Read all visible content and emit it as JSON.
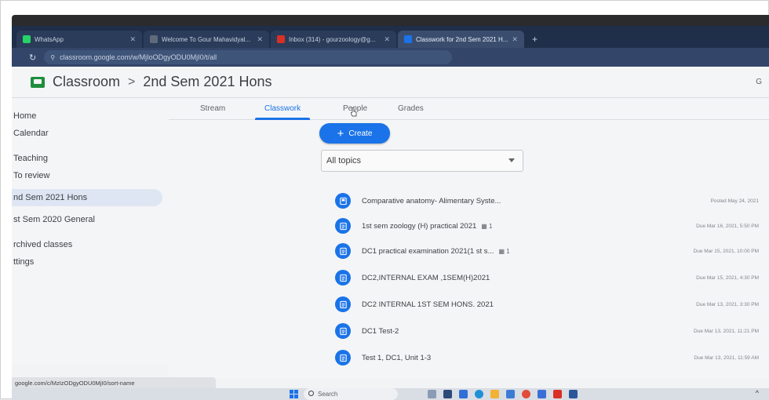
{
  "browser": {
    "tabs": [
      {
        "label": "WhatsApp",
        "color": "#25d366",
        "active": false
      },
      {
        "label": "Welcome To Gour Mahavidyal...",
        "color": "#5f6b7a",
        "active": false
      },
      {
        "label": "Inbox (314) - gourzoology@g...",
        "color": "#d93025",
        "active": false
      },
      {
        "label": "Classwork for 2nd Sem 2021 H...",
        "color": "#1a73e8",
        "active": true
      }
    ],
    "newtab": "+",
    "nav_back": "←",
    "nav_reload": "↻",
    "url": "classroom.google.com/w/MjIoODgyODU0MjI0/t/all"
  },
  "app": {
    "title": "Classroom",
    "separator": ">",
    "class_name": "2nd Sem 2021 Hons",
    "right_glyph": "G"
  },
  "sidebar": {
    "items": [
      {
        "label": "Home",
        "selected": false
      },
      {
        "label": "Calendar",
        "selected": false
      },
      {
        "label": "Teaching",
        "selected": false
      },
      {
        "label": "To review",
        "selected": false
      },
      {
        "label": "nd Sem 2021 Hons",
        "selected": true
      },
      {
        "label": "st Sem 2020 General",
        "selected": false
      },
      {
        "label": "rchived classes",
        "selected": false
      },
      {
        "label": "ttings",
        "selected": false
      }
    ]
  },
  "class_tabs": [
    {
      "label": "Stream",
      "active": false
    },
    {
      "label": "Classwork",
      "active": true
    },
    {
      "label": "People",
      "active": false
    },
    {
      "label": "Grades",
      "active": false
    }
  ],
  "classwork": {
    "create_label": "Create",
    "create_plus": "+",
    "topic_filter": "All topics",
    "items": [
      {
        "title": "Comparative anatomy- Alimentary Syste...",
        "badge": "",
        "date": "Posted May 24, 2021",
        "icon": "material-icon"
      },
      {
        "title": "1st sem zoology (H) practical 2021",
        "badge": "▦ 1",
        "date": "Due Mar 16, 2021, 5:50 PM",
        "icon": "assignment-icon"
      },
      {
        "title": "DC1 practical examination 2021(1 st s...",
        "badge": "▦ 1",
        "date": "Due Mar 15, 2021, 10:00 PM",
        "icon": "assignment-icon"
      },
      {
        "title": "DC2,INTERNAL EXAM ,1SEM(H)2021",
        "badge": "",
        "date": "Due Mar 15, 2021, 4:30 PM",
        "icon": "assignment-icon"
      },
      {
        "title": "DC2 INTERNAL 1ST SEM HONS. 2021",
        "badge": "",
        "date": "Due Mar 13, 2021, 3:30 PM",
        "icon": "assignment-icon"
      },
      {
        "title": "DC1 Test-2",
        "badge": "",
        "date": "Due Mar 13, 2021, 11:21 PM",
        "icon": "assignment-icon"
      },
      {
        "title": "Test 1, DC1, Unit 1-3",
        "badge": "",
        "date": "Due Mar 13, 2021, 11:59 AM",
        "icon": "assignment-icon"
      }
    ]
  },
  "status_url": "google.com/c/MzIzODgyODU0MjI0/sort-name",
  "taskbar": {
    "search_label": "Search",
    "tray": "^"
  }
}
